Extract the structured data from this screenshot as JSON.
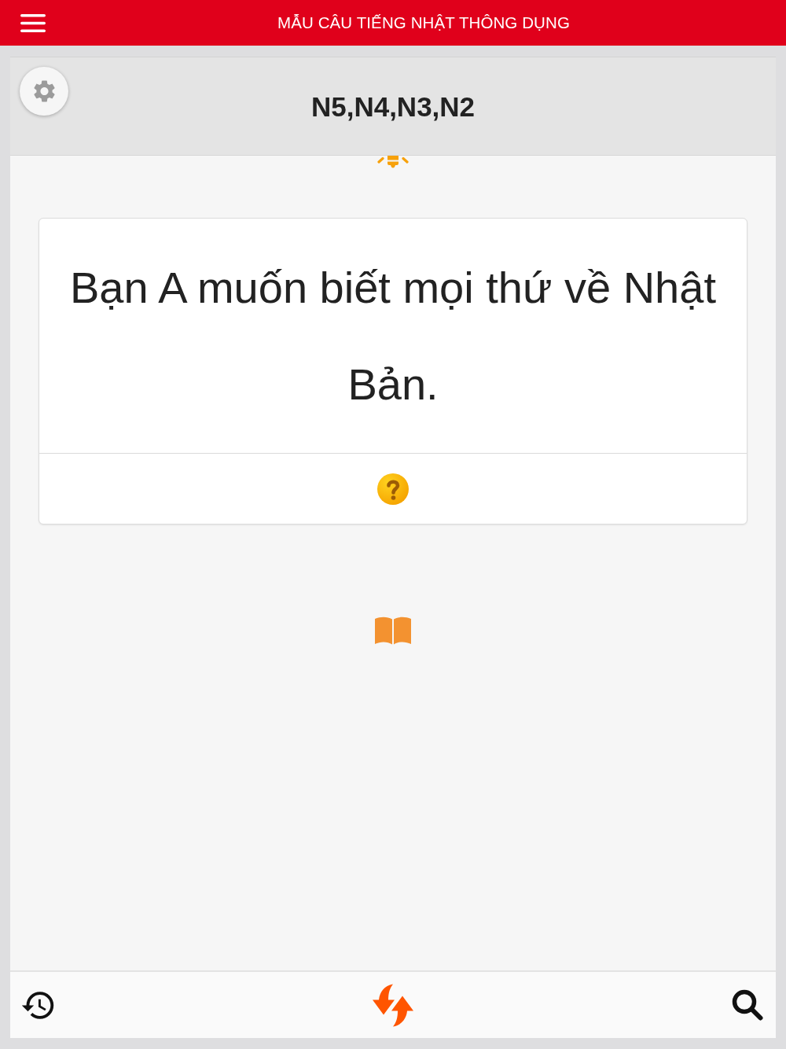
{
  "app_bar": {
    "title": "MẪU CÂU TIẾNG NHẬT THÔNG DỤNG"
  },
  "level_header": {
    "title": "N5,N4,N3,N2"
  },
  "card": {
    "sentence": "Bạn A muốn biết mọi thứ về Nhật Bản."
  }
}
